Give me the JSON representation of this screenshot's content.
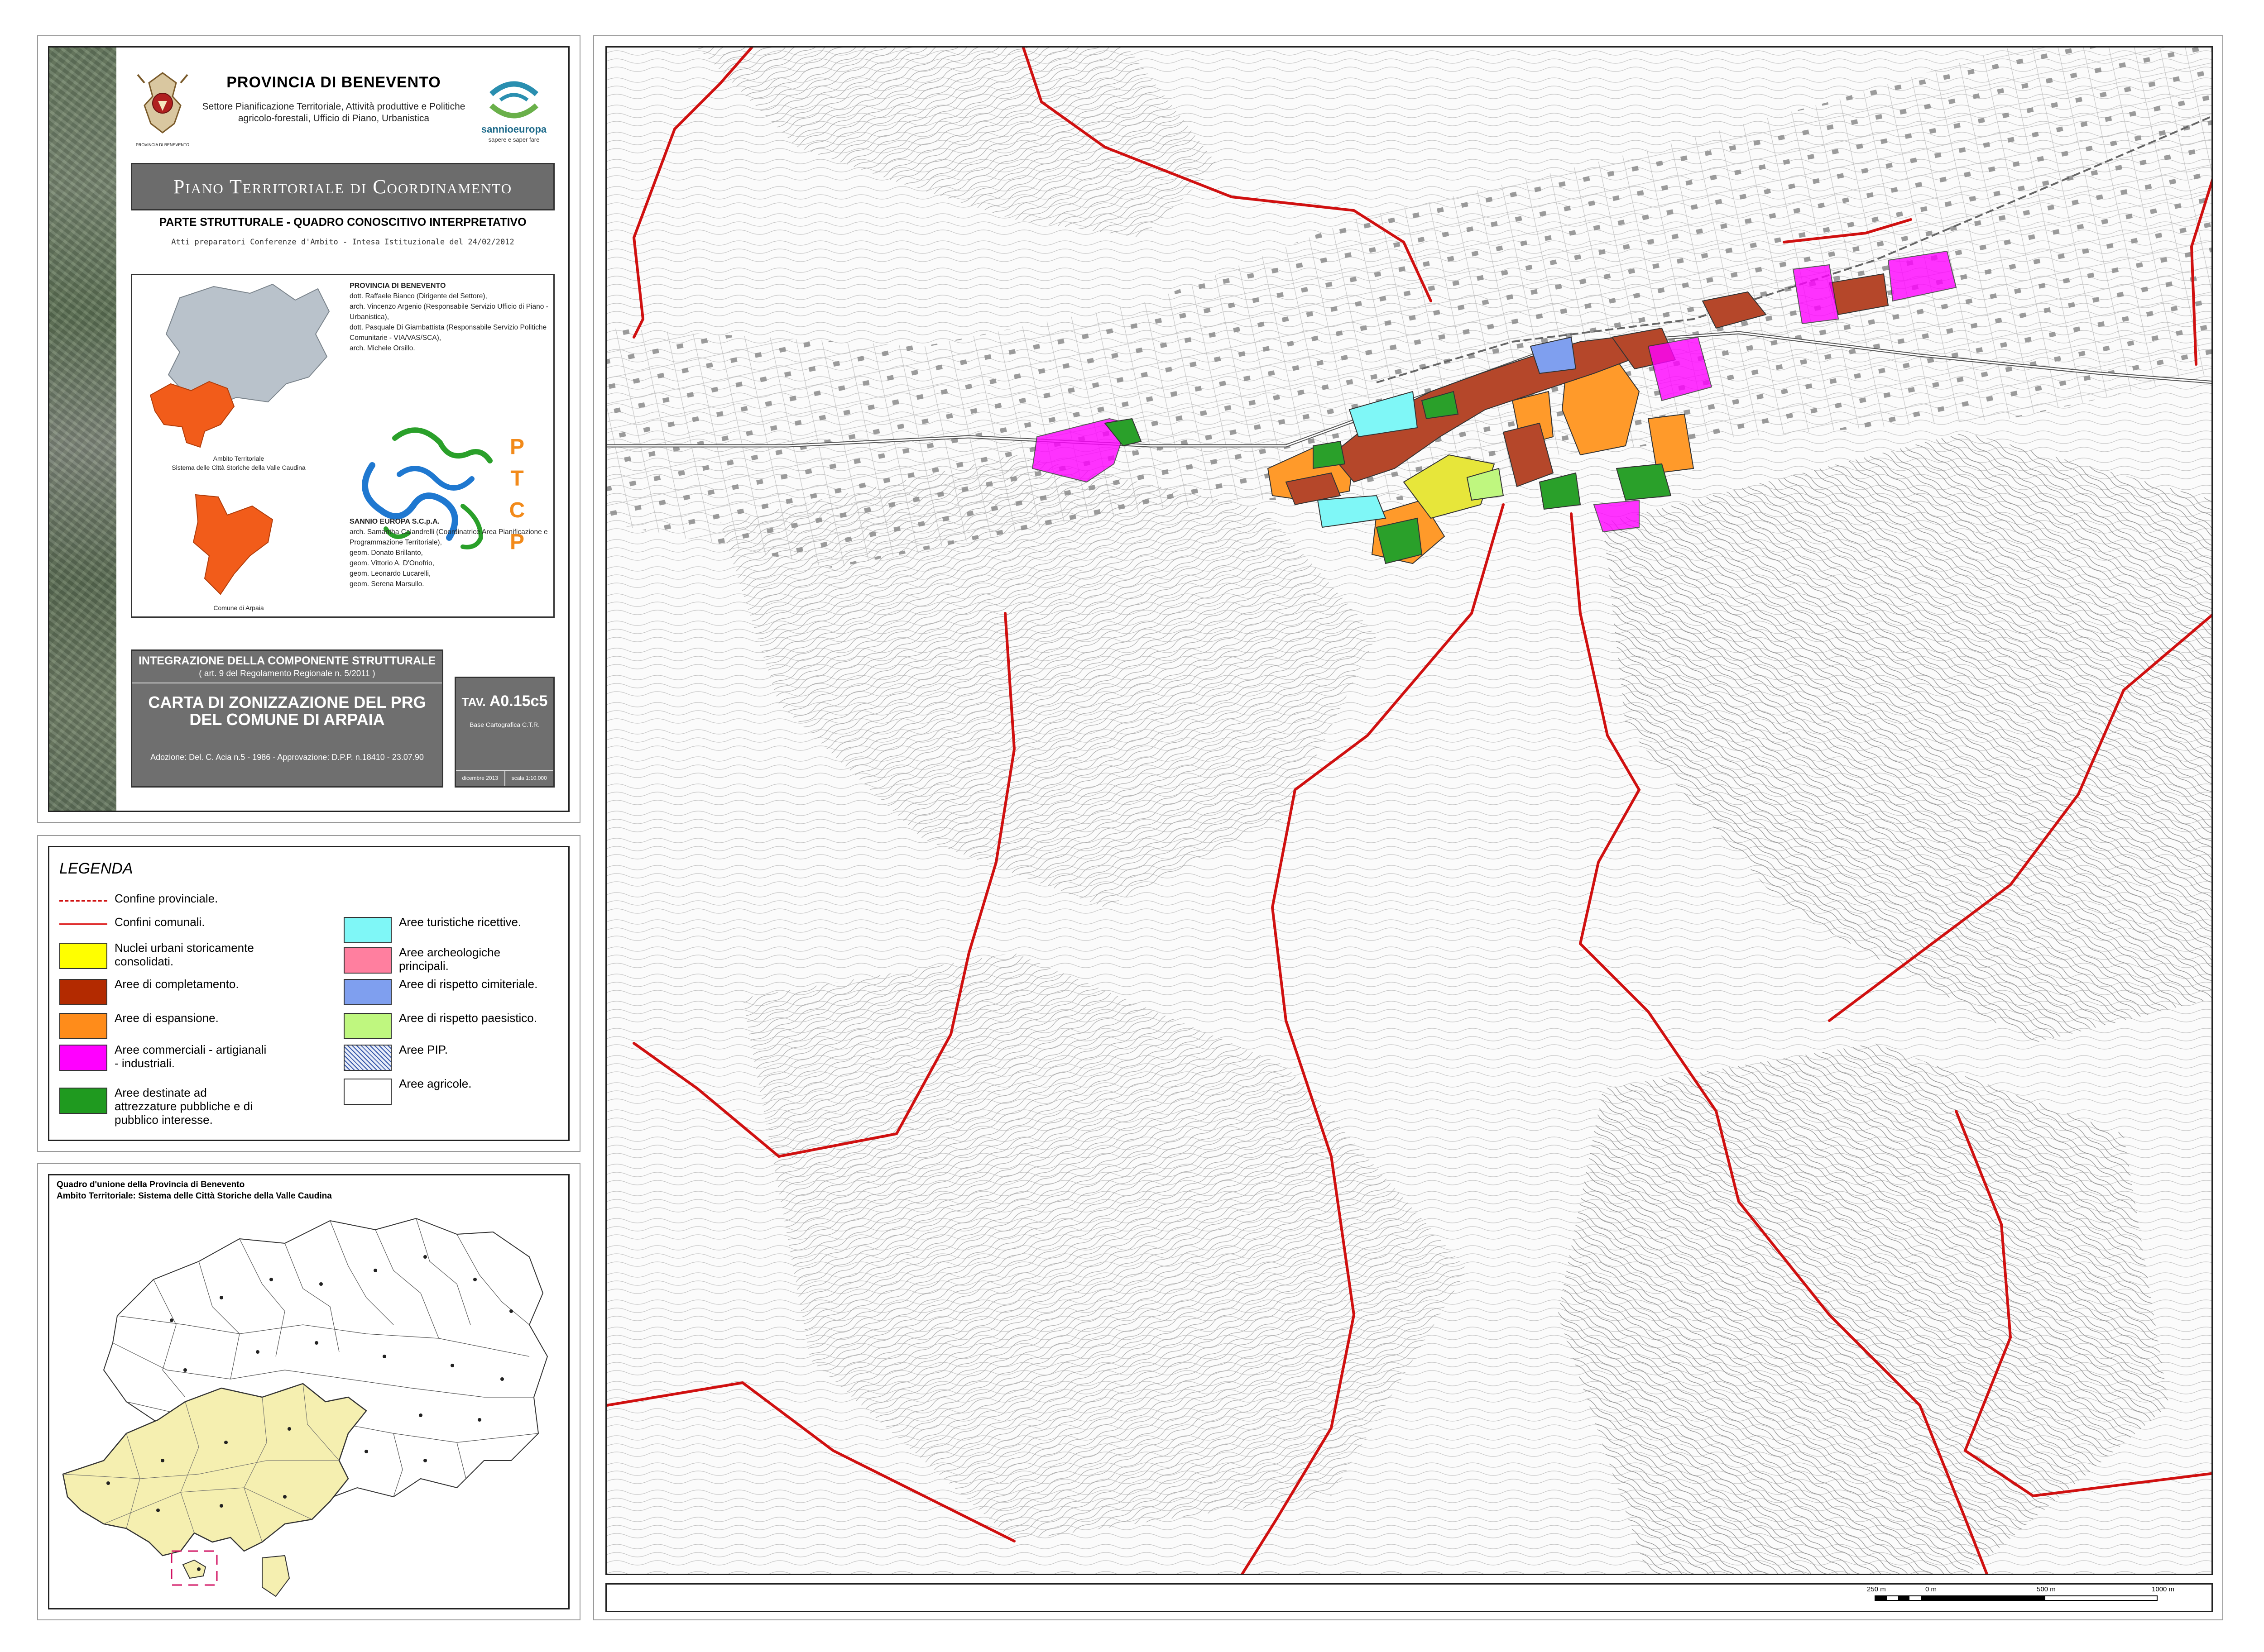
{
  "header": {
    "province": "PROVINCIA DI BENEVENTO",
    "sector": "Settore Pianificazione Territoriale, Attività produttive e Politiche agricolo-forestali, Ufficio di Piano, Urbanistica",
    "logo_left_caption": "PROVINCIA DI BENEVENTO",
    "logo_right_name": "sannioeuropa",
    "logo_right_tagline": "sapere e saper fare"
  },
  "plan": {
    "title": "Piano Territoriale di Coordinamento Provinciale",
    "part": "PARTE STRUTTURALE - QUADRO CONOSCITIVO INTERPRETATIVO",
    "acts": "Atti preparatori Conferenze d'Ambito - Intesa Istituzionale del 24/02/2012"
  },
  "credits": {
    "org1": "PROVINCIA DI BENEVENTO",
    "org1_people": [
      "dott. Raffaele Bianco (Dirigente del Settore),",
      "arch. Vincenzo Argenio (Responsabile Servizio Ufficio di Piano - Urbanistica),",
      "dott. Pasquale Di Giambattista (Responsabile Servizio Politiche Comunitarie - VIA/VAS/SCA),",
      "arch. Michele Orsillo."
    ],
    "org2": "SANNIO EUROPA S.C.p.A.",
    "org2_people": [
      "arch. Samantha Calandrelli (Coordinatrice Area Pianificazione e Programmazione Territoriale),",
      "geom. Donato Brillanto,",
      "geom. Vittorio A. D'Onofrio,",
      "geom. Leonardo Lucarelli,",
      "geom. Serena Marsullo."
    ],
    "ambito_caption": "Ambito Territoriale\nSistema delle Città Storiche della Valle Caudina",
    "comune_caption": "Comune di Arpaia",
    "ptcp_letters": [
      "P",
      "T",
      "C",
      "P"
    ]
  },
  "integration": {
    "line1": "INTEGRAZIONE DELLA COMPONENTE STRUTTURALE",
    "line2": "( art. 9 del Regolamento Regionale n. 5/2011 )",
    "map_title": "CARTA DI ZONIZZAZIONE DEL PRG DEL COMUNE DI ARPAIA",
    "approval": "Adozione: Del. C. Acia n.5 - 1986 - Approvazione: D.P.P. n.18410 - 23.07.90"
  },
  "tav": {
    "prefix": "TAV.",
    "code": "A0.15c5",
    "base": "Base Cartografica C.T.R.",
    "date": "dicembre 2013",
    "scale": "scala 1:10.000"
  },
  "legend": {
    "title": "LEGENDA",
    "items": [
      {
        "label": "Confine provinciale.",
        "kind": "line-dashed",
        "color": "#d01010"
      },
      {
        "label": "Confini comunali.",
        "kind": "line",
        "color": "#e03030"
      },
      {
        "label": "Nuclei urbani storicamente consolidati.",
        "kind": "fill",
        "color": "#ffff00"
      },
      {
        "label": "Aree di completamento.",
        "kind": "fill",
        "color": "#b32a00"
      },
      {
        "label": "Aree di espansione.",
        "kind": "fill",
        "color": "#ff8c1a"
      },
      {
        "label": "Aree commerciali - artigianali - industriali.",
        "kind": "fill",
        "color": "#ff00ff"
      },
      {
        "label": "Aree destinate ad attrezzature pubbliche e di pubblico interesse.",
        "kind": "fill",
        "color": "#1f9a1f"
      },
      {
        "label": "Aree turistiche ricettive.",
        "kind": "fill",
        "color": "#7ff7f7"
      },
      {
        "label": "Aree archeologiche principali.",
        "kind": "fill",
        "color": "#ff7f9f"
      },
      {
        "label": "Aree di rispetto cimiteriale.",
        "kind": "fill",
        "color": "#7f9fef"
      },
      {
        "label": "Aree di rispetto paesistico.",
        "kind": "fill",
        "color": "#bff77f"
      },
      {
        "label": "Aree PIP.",
        "kind": "hatch",
        "color": "#3355aa"
      },
      {
        "label": "Aree agricole.",
        "kind": "fill",
        "color": "#ffffff"
      }
    ]
  },
  "quadro": {
    "title": "Quadro d'unione della Provincia di Benevento",
    "subtitle": "Ambito Territoriale: Sistema delle Città Storiche della Valle Caudina"
  },
  "scale_bar": {
    "labels": [
      "250 m",
      "0 m",
      "500 m",
      "1000 m"
    ]
  },
  "colors": {
    "boundary_red": "#d01010",
    "panel_grey": "#6f6f6f",
    "province_grey": "#b9c2cb",
    "ambito_orange": "#f25c1a",
    "ambito_yellow": "#f5efb0"
  }
}
